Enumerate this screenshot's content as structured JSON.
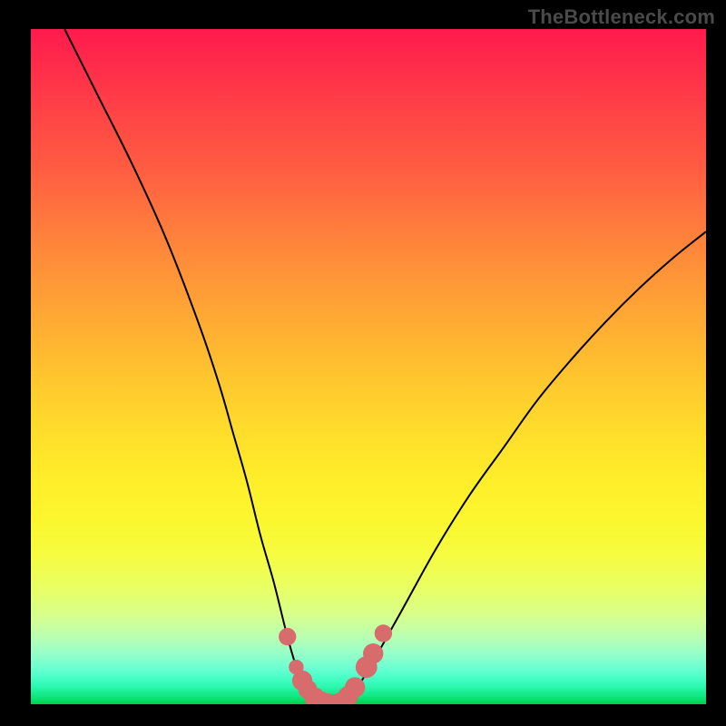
{
  "watermark": "TheBottleneck.com",
  "chart_data": {
    "type": "line",
    "title": "",
    "xlabel": "",
    "ylabel": "",
    "xlim": [
      0,
      100
    ],
    "ylim": [
      0,
      100
    ],
    "series": [
      {
        "name": "bottleneck-curve",
        "x": [
          5,
          10,
          15,
          20,
          25,
          28,
          30,
          32,
          34,
          36,
          38,
          39.5,
          41,
          43,
          44.5,
          46,
          48,
          50.5,
          55,
          60,
          65,
          70,
          75,
          80,
          85,
          90,
          95,
          100
        ],
        "values": [
          100,
          90,
          80,
          69,
          56,
          47,
          40,
          33,
          25,
          18,
          10,
          5,
          2,
          0,
          0,
          0,
          2,
          6,
          14,
          23,
          31,
          38,
          45,
          51,
          56.5,
          61.5,
          66,
          70
        ]
      }
    ],
    "markers": {
      "name": "curve-markers",
      "color": "#d86b6b",
      "points": [
        {
          "x": 38.0,
          "y": 10.0,
          "r": 1.3
        },
        {
          "x": 39.3,
          "y": 5.5,
          "r": 1.1
        },
        {
          "x": 40.2,
          "y": 3.5,
          "r": 1.5
        },
        {
          "x": 41.0,
          "y": 2.2,
          "r": 1.4
        },
        {
          "x": 42.0,
          "y": 1.0,
          "r": 1.5
        },
        {
          "x": 43.0,
          "y": 0.4,
          "r": 1.5
        },
        {
          "x": 44.0,
          "y": 0.1,
          "r": 1.5
        },
        {
          "x": 45.0,
          "y": 0.0,
          "r": 1.5
        },
        {
          "x": 46.0,
          "y": 0.3,
          "r": 1.5
        },
        {
          "x": 47.0,
          "y": 1.2,
          "r": 1.5
        },
        {
          "x": 48.0,
          "y": 2.5,
          "r": 1.5
        },
        {
          "x": 49.7,
          "y": 5.5,
          "r": 1.6
        },
        {
          "x": 50.7,
          "y": 7.5,
          "r": 1.5
        },
        {
          "x": 52.2,
          "y": 10.5,
          "r": 1.3
        }
      ]
    },
    "gradient_stops": [
      {
        "pos": 0,
        "color": "#ff1a4d"
      },
      {
        "pos": 20,
        "color": "#ff5a42"
      },
      {
        "pos": 40,
        "color": "#ffa436"
      },
      {
        "pos": 60,
        "color": "#ffde2b"
      },
      {
        "pos": 78,
        "color": "#f5fc41"
      },
      {
        "pos": 90,
        "color": "#baffb2"
      },
      {
        "pos": 96,
        "color": "#4affc9"
      },
      {
        "pos": 100,
        "color": "#00ce46"
      }
    ]
  }
}
